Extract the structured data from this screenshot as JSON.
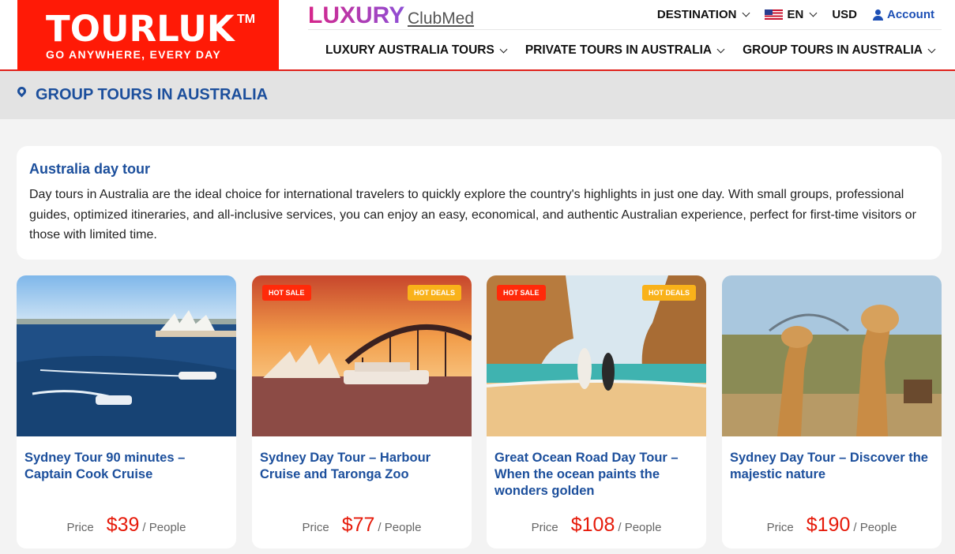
{
  "header": {
    "logo": {
      "name": "TOURLUK",
      "tm": "TM",
      "tagline": "GO ANYWHERE, EVERY DAY"
    },
    "brand_luxury": "LUXURY",
    "brand_clubmed": "ClubMed",
    "topnav": {
      "destination": "DESTINATION",
      "language": "EN",
      "currency": "USD",
      "account": "Account"
    },
    "mainnav": [
      {
        "label": "LUXURY AUSTRALIA TOURS"
      },
      {
        "label": "PRIVATE TOURS IN AUSTRALIA"
      },
      {
        "label": "GROUP TOURS IN AUSTRALIA"
      }
    ]
  },
  "breadcrumb": {
    "title": "GROUP TOURS IN AUSTRALIA"
  },
  "intro": {
    "heading": "Australia day tour",
    "text": "Day tours in Australia are the ideal choice for international travelers to quickly explore the country's highlights in just one day. With small groups, professional guides, optimized itineraries, and all-inclusive services, you can enjoy an easy, economical, and authentic Australian experience, perfect for first-time visitors or those with limited time."
  },
  "tours": [
    {
      "title": "Sydney Tour 90 minutes – Captain Cook Cruise",
      "price_label": "Price",
      "price": "$39",
      "unit": "/ People",
      "hot": "",
      "deal": ""
    },
    {
      "title": "Sydney Day Tour – Harbour Cruise and Taronga Zoo",
      "price_label": "Price",
      "price": "$77",
      "unit": "/ People",
      "hot": "HOT SALE",
      "deal": "HOT DEALS"
    },
    {
      "title": "Great Ocean Road Day Tour – When the ocean paints the wonders golden",
      "price_label": "Price",
      "price": "$108",
      "unit": "/ People",
      "hot": "HOT SALE",
      "deal": "HOT DEALS"
    },
    {
      "title": "Sydney Day Tour – Discover the majestic nature",
      "price_label": "Price",
      "price": "$190",
      "unit": "/ People",
      "hot": "",
      "deal": ""
    }
  ],
  "colors": {
    "brand_red": "#ff1a06",
    "link_blue": "#1c4f9c",
    "price_red": "#e61a0a",
    "deal_yellow": "#f9b21a"
  }
}
